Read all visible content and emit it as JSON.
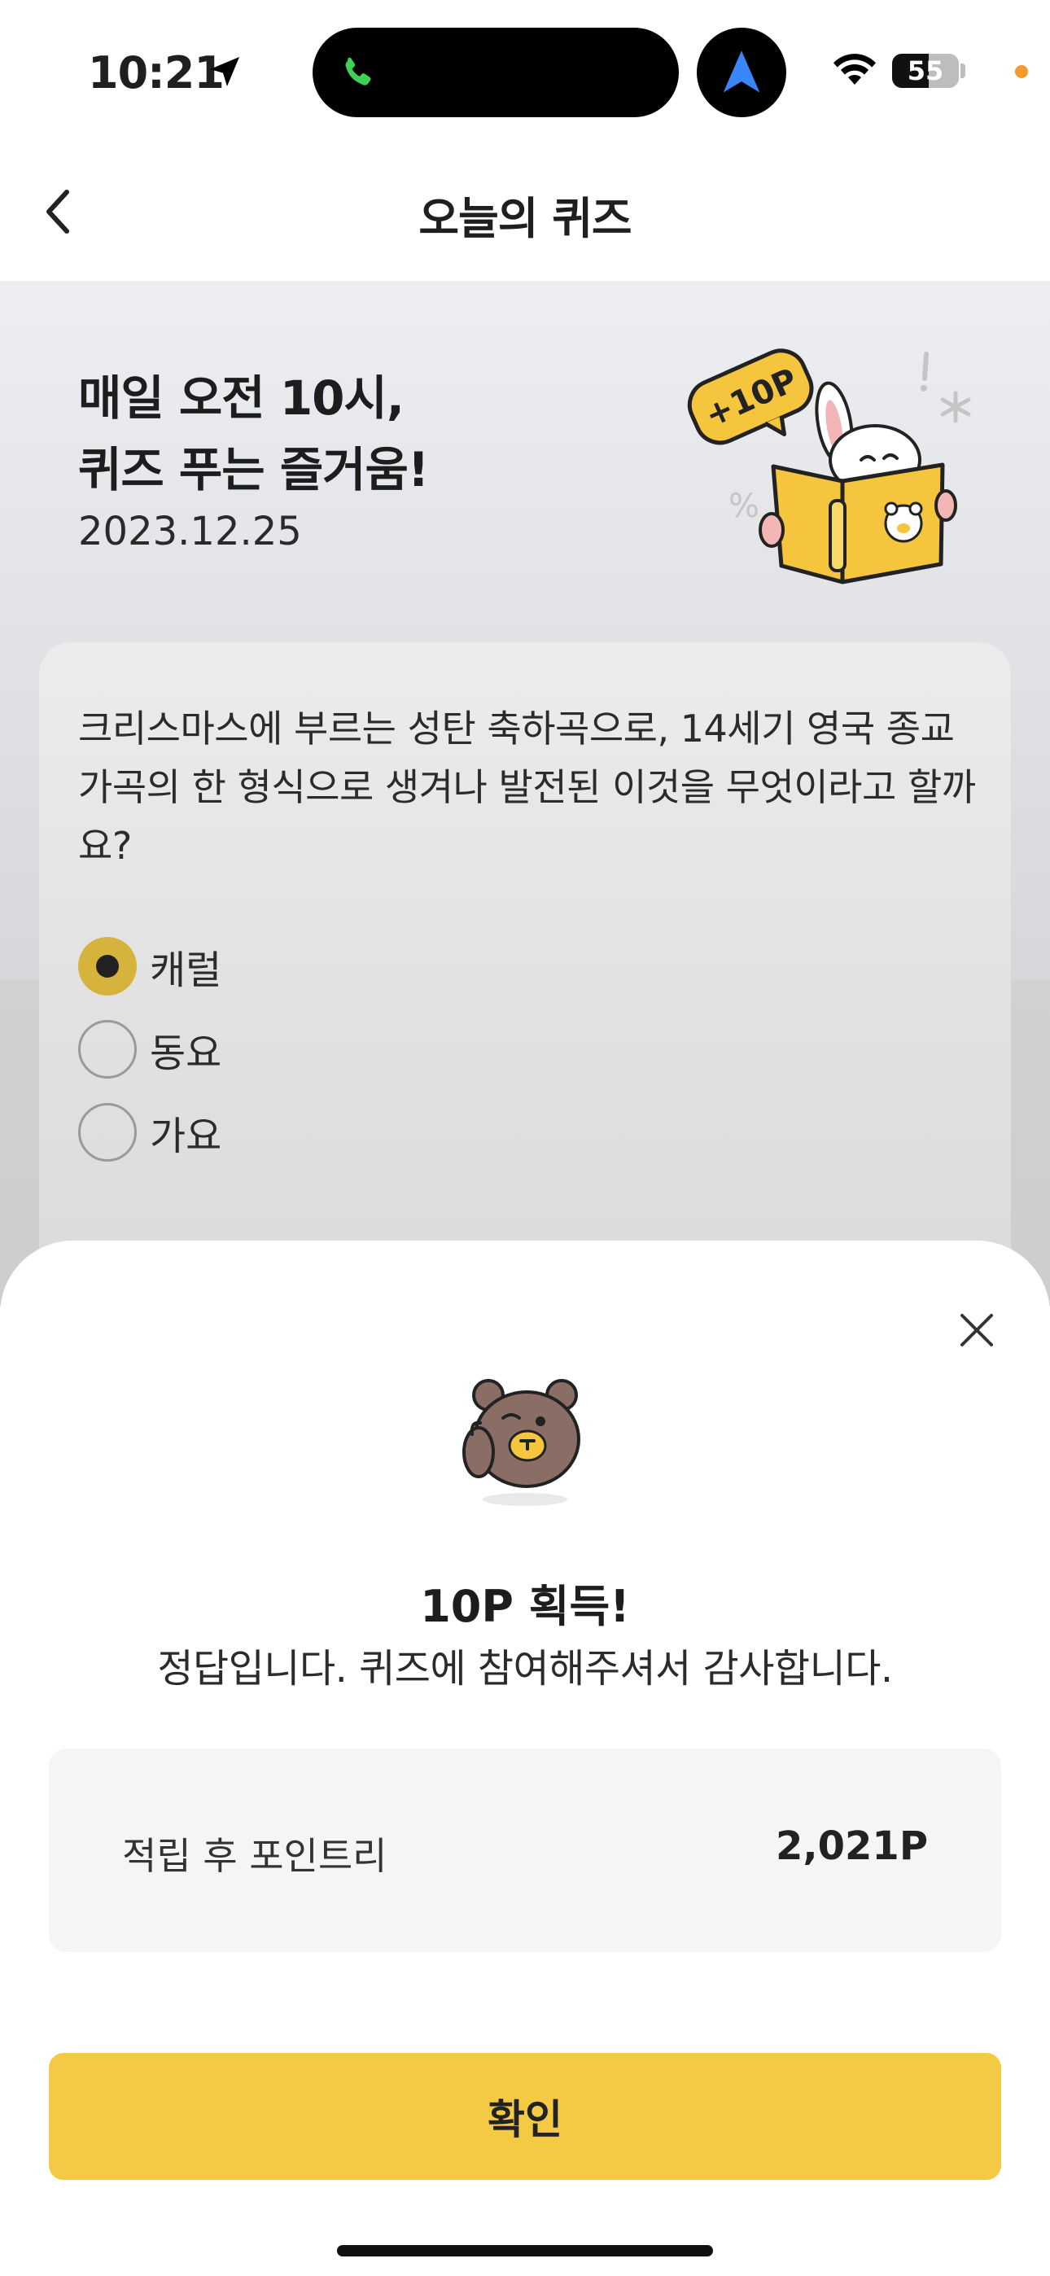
{
  "status_bar": {
    "time": "10:21",
    "battery_level": "55",
    "battery_percent": 55,
    "icons": [
      "location-arrow-icon",
      "phone-call-icon",
      "navigation-icon",
      "wifi-icon",
      "battery-icon"
    ]
  },
  "header": {
    "title": "오늘의 퀴즈",
    "back_icon": "chevron-left-icon"
  },
  "hero": {
    "title_line1": "매일 오전 10시,",
    "title_line2": "퀴즈 푸는 즐거움!",
    "date": "2023.12.25",
    "badge": "+10P"
  },
  "quiz": {
    "question": "크리스마스에 부르는 성탄 축하곡으로, 14세기 영국 종교 가곡의 한 형식으로 생겨나 발전된 이것을 무엇이라고 할까요?",
    "options": [
      {
        "label": "캐럴",
        "selected": true
      },
      {
        "label": "동요",
        "selected": false
      },
      {
        "label": "가요",
        "selected": false
      }
    ]
  },
  "result_sheet": {
    "title": "10P 획득!",
    "message": "정답입니다. 퀴즈에 참여해주셔서 감사합니다.",
    "points_label": "적립 후 포인트리",
    "points_value": "2,021P",
    "confirm_label": "확인"
  },
  "colors": {
    "accent_yellow": "#f4ca45",
    "radio_selected": "#d5b33c",
    "points_box_bg": "#f5f5f6"
  }
}
